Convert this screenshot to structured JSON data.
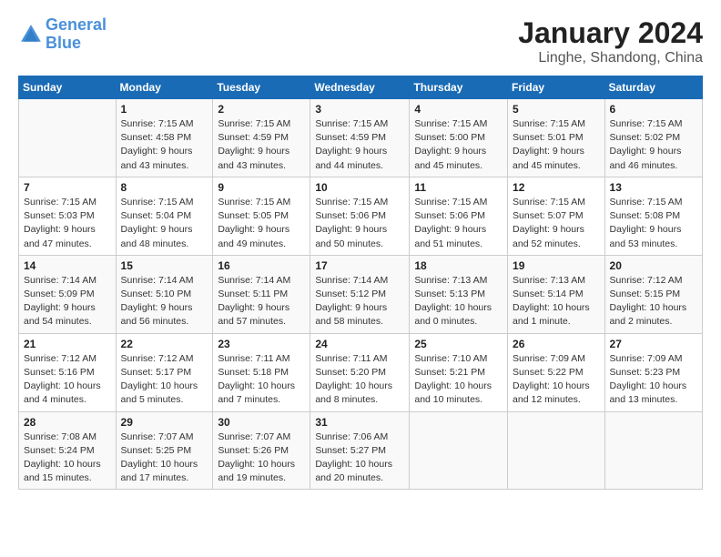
{
  "logo": {
    "line1": "General",
    "line2": "Blue"
  },
  "title": "January 2024",
  "subtitle": "Linghe, Shandong, China",
  "weekdays": [
    "Sunday",
    "Monday",
    "Tuesday",
    "Wednesday",
    "Thursday",
    "Friday",
    "Saturday"
  ],
  "weeks": [
    [
      {
        "day": "",
        "info": ""
      },
      {
        "day": "1",
        "info": "Sunrise: 7:15 AM\nSunset: 4:58 PM\nDaylight: 9 hours\nand 43 minutes."
      },
      {
        "day": "2",
        "info": "Sunrise: 7:15 AM\nSunset: 4:59 PM\nDaylight: 9 hours\nand 43 minutes."
      },
      {
        "day": "3",
        "info": "Sunrise: 7:15 AM\nSunset: 4:59 PM\nDaylight: 9 hours\nand 44 minutes."
      },
      {
        "day": "4",
        "info": "Sunrise: 7:15 AM\nSunset: 5:00 PM\nDaylight: 9 hours\nand 45 minutes."
      },
      {
        "day": "5",
        "info": "Sunrise: 7:15 AM\nSunset: 5:01 PM\nDaylight: 9 hours\nand 45 minutes."
      },
      {
        "day": "6",
        "info": "Sunrise: 7:15 AM\nSunset: 5:02 PM\nDaylight: 9 hours\nand 46 minutes."
      }
    ],
    [
      {
        "day": "7",
        "info": "Sunrise: 7:15 AM\nSunset: 5:03 PM\nDaylight: 9 hours\nand 47 minutes."
      },
      {
        "day": "8",
        "info": "Sunrise: 7:15 AM\nSunset: 5:04 PM\nDaylight: 9 hours\nand 48 minutes."
      },
      {
        "day": "9",
        "info": "Sunrise: 7:15 AM\nSunset: 5:05 PM\nDaylight: 9 hours\nand 49 minutes."
      },
      {
        "day": "10",
        "info": "Sunrise: 7:15 AM\nSunset: 5:06 PM\nDaylight: 9 hours\nand 50 minutes."
      },
      {
        "day": "11",
        "info": "Sunrise: 7:15 AM\nSunset: 5:06 PM\nDaylight: 9 hours\nand 51 minutes."
      },
      {
        "day": "12",
        "info": "Sunrise: 7:15 AM\nSunset: 5:07 PM\nDaylight: 9 hours\nand 52 minutes."
      },
      {
        "day": "13",
        "info": "Sunrise: 7:15 AM\nSunset: 5:08 PM\nDaylight: 9 hours\nand 53 minutes."
      }
    ],
    [
      {
        "day": "14",
        "info": "Sunrise: 7:14 AM\nSunset: 5:09 PM\nDaylight: 9 hours\nand 54 minutes."
      },
      {
        "day": "15",
        "info": "Sunrise: 7:14 AM\nSunset: 5:10 PM\nDaylight: 9 hours\nand 56 minutes."
      },
      {
        "day": "16",
        "info": "Sunrise: 7:14 AM\nSunset: 5:11 PM\nDaylight: 9 hours\nand 57 minutes."
      },
      {
        "day": "17",
        "info": "Sunrise: 7:14 AM\nSunset: 5:12 PM\nDaylight: 9 hours\nand 58 minutes."
      },
      {
        "day": "18",
        "info": "Sunrise: 7:13 AM\nSunset: 5:13 PM\nDaylight: 10 hours\nand 0 minutes."
      },
      {
        "day": "19",
        "info": "Sunrise: 7:13 AM\nSunset: 5:14 PM\nDaylight: 10 hours\nand 1 minute."
      },
      {
        "day": "20",
        "info": "Sunrise: 7:12 AM\nSunset: 5:15 PM\nDaylight: 10 hours\nand 2 minutes."
      }
    ],
    [
      {
        "day": "21",
        "info": "Sunrise: 7:12 AM\nSunset: 5:16 PM\nDaylight: 10 hours\nand 4 minutes."
      },
      {
        "day": "22",
        "info": "Sunrise: 7:12 AM\nSunset: 5:17 PM\nDaylight: 10 hours\nand 5 minutes."
      },
      {
        "day": "23",
        "info": "Sunrise: 7:11 AM\nSunset: 5:18 PM\nDaylight: 10 hours\nand 7 minutes."
      },
      {
        "day": "24",
        "info": "Sunrise: 7:11 AM\nSunset: 5:20 PM\nDaylight: 10 hours\nand 8 minutes."
      },
      {
        "day": "25",
        "info": "Sunrise: 7:10 AM\nSunset: 5:21 PM\nDaylight: 10 hours\nand 10 minutes."
      },
      {
        "day": "26",
        "info": "Sunrise: 7:09 AM\nSunset: 5:22 PM\nDaylight: 10 hours\nand 12 minutes."
      },
      {
        "day": "27",
        "info": "Sunrise: 7:09 AM\nSunset: 5:23 PM\nDaylight: 10 hours\nand 13 minutes."
      }
    ],
    [
      {
        "day": "28",
        "info": "Sunrise: 7:08 AM\nSunset: 5:24 PM\nDaylight: 10 hours\nand 15 minutes."
      },
      {
        "day": "29",
        "info": "Sunrise: 7:07 AM\nSunset: 5:25 PM\nDaylight: 10 hours\nand 17 minutes."
      },
      {
        "day": "30",
        "info": "Sunrise: 7:07 AM\nSunset: 5:26 PM\nDaylight: 10 hours\nand 19 minutes."
      },
      {
        "day": "31",
        "info": "Sunrise: 7:06 AM\nSunset: 5:27 PM\nDaylight: 10 hours\nand 20 minutes."
      },
      {
        "day": "",
        "info": ""
      },
      {
        "day": "",
        "info": ""
      },
      {
        "day": "",
        "info": ""
      }
    ]
  ]
}
